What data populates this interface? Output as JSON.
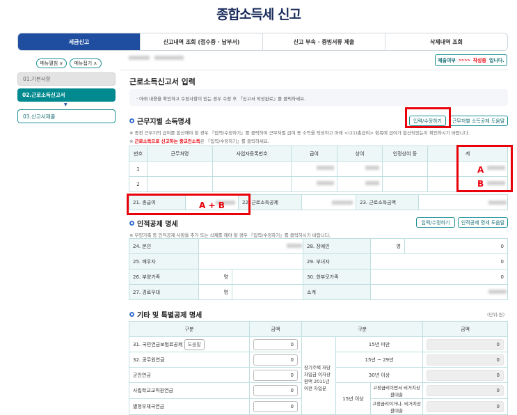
{
  "title": "종합소득세 신고",
  "tabs": [
    "세금신고",
    "신고내역 조회 (접수증 · 납부서)",
    "신고 부속 · 증빙서류 제출",
    "삭제내역 조회"
  ],
  "sidebar": {
    "expand": "메뉴펼침 ∨",
    "collapse": "메뉴접기 ∧",
    "steps": [
      "01.기본사항",
      "02.근로소득신고서",
      "03.신고서제출"
    ],
    "arrow": "▼"
  },
  "status": {
    "label": "제출여부",
    "arrows": ">>>>",
    "state": "작성중",
    "suffix": "입니다.",
    "state_color": "#e8000b"
  },
  "page_heading": "근로소득신고서 입력",
  "info": "· 아래 내용을 확인하고 수정사항이 있는 경우 수정 후 『신고서 작성완료』를 클릭하세요.",
  "work": {
    "title": "근무지별 소득명세",
    "btn_edit": "입력/수정하기",
    "btn_help": "근무처별 소득공제 도움말",
    "note1": "※ 종전 근무지의 급여를 합산해야 할 경우 『입력/수정하기』를 클릭하여 근무처별 급여 등 소득을 작성하고 아래 <(21)총급여> 항목에 급여가 합산되었는지 확인하시기 바랍니다.",
    "note2_red": "근로소득으로 신고하는 종교인소득",
    "note2_prefix": "※ ",
    "note2_suffix": "은 『입력/수정하기』를 클릭하세요.",
    "headers": [
      "번호",
      "근무처명",
      "사업자등록번호",
      "급여",
      "상여",
      "인정상여 등",
      "계"
    ],
    "rows": [
      "1",
      "2"
    ],
    "total_label": "21. 총급여",
    "deduct_label": "22. 근로소득공제",
    "income_label": "23. 근로소득금액",
    "annot_a": "A",
    "annot_b": "B",
    "annot_sum": "A + B"
  },
  "personal": {
    "title": "인적공제 명세",
    "btn_edit": "입력/수정하기",
    "btn_help": "인적공제 명세 도움말",
    "note": "※ 부양가족 등 인적공제 사항을 추가 또는 삭제를 해야 할 경우 『입력/수정하기』를 클릭하시기 바랍니다.",
    "r1": "24. 본인",
    "r2": "25. 배우자",
    "r3": "26. 부양가족",
    "r4": "27. 경로우대",
    "l1": "28. 장애인",
    "l2": "29. 부녀자",
    "l3": "30. 한부모가족",
    "l4": "소계",
    "unit": "명",
    "v28": "0",
    "v29": "0",
    "v30": "0"
  },
  "special": {
    "title": "기타 및 특별공제 명세",
    "unit": "(단위:원)",
    "h1": "구분",
    "h2": "금액",
    "h3": "구분",
    "h4": "금액",
    "left": [
      "31. 국민연금보험료공제",
      "32. 공무원연금",
      "군인연금",
      "사립학교교직원연금",
      "별정우체국연금"
    ],
    "help": "도움말",
    "left_vals": [
      "0",
      "0",
      "0",
      "0",
      "0"
    ],
    "group": "장기주택 저당차입금 이자상환액 2011년 이전 차입분",
    "sub": [
      "15년 미만",
      "15년 ~ 29년",
      "30년 이상"
    ],
    "sub15": "15년 이상",
    "subsub": [
      "고정금리이면서 비거치상환대출",
      "고정금리이거나, 비거치상환대출"
    ],
    "right_vals": [
      "0",
      "0",
      "0",
      "0",
      "0"
    ]
  }
}
